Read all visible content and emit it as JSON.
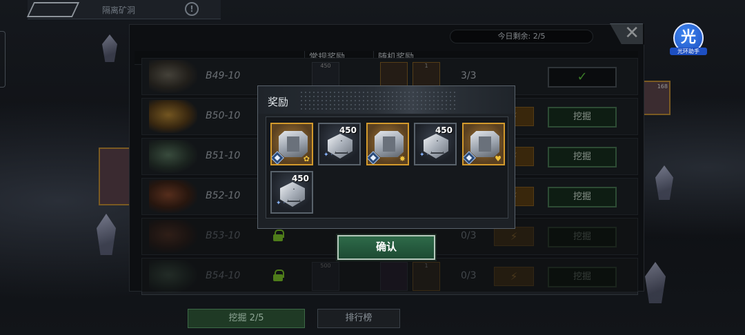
{
  "background": {
    "title": "隔离矿洞",
    "info_icon": "info-icon",
    "side_card_count": "168"
  },
  "helper": {
    "glyph": "光",
    "label": "光环助手"
  },
  "panel": {
    "daily_remaining": "今日剩余: 2/5",
    "close_icon": "close-icon",
    "columns": {
      "regular": "常规奖励",
      "random": "随机奖励"
    },
    "rows": [
      {
        "name": "B49-10",
        "count": "3/3",
        "regular_qty": "450",
        "random_qty": "1",
        "status": "done",
        "check_glyph": "✓",
        "locked": false
      },
      {
        "name": "B50-10",
        "count": "",
        "status": "dig",
        "button": "挖掘",
        "locked": false
      },
      {
        "name": "B51-10",
        "count": "",
        "status": "dig",
        "button": "挖掘",
        "locked": false
      },
      {
        "name": "B52-10",
        "count": "",
        "status": "dig",
        "button": "挖掘",
        "locked": false
      },
      {
        "name": "B53-10",
        "count": "0/3",
        "status": "locked",
        "button": "挖掘",
        "locked": true
      },
      {
        "name": "B54-10",
        "count": "0/3",
        "regular_qty": "500",
        "random_qty": "1",
        "status": "locked",
        "button": "挖掘",
        "locked": true
      }
    ],
    "bottom": {
      "dig": "挖掘 2/5",
      "rank": "排行榜"
    }
  },
  "modal": {
    "title": "奖励",
    "items": [
      {
        "kind": "gear",
        "rarity": "gold",
        "qty": "",
        "stat_glyph": "✿"
      },
      {
        "kind": "crystal",
        "rarity": "common",
        "qty": "450"
      },
      {
        "kind": "gear",
        "rarity": "gold",
        "qty": "",
        "stat_glyph": "✸"
      },
      {
        "kind": "crystal",
        "rarity": "common",
        "qty": "450"
      },
      {
        "kind": "gear",
        "rarity": "gold",
        "qty": "",
        "stat_glyph": "♥"
      },
      {
        "kind": "crystal",
        "rarity": "common",
        "qty": "450"
      }
    ],
    "confirm": "确认"
  }
}
